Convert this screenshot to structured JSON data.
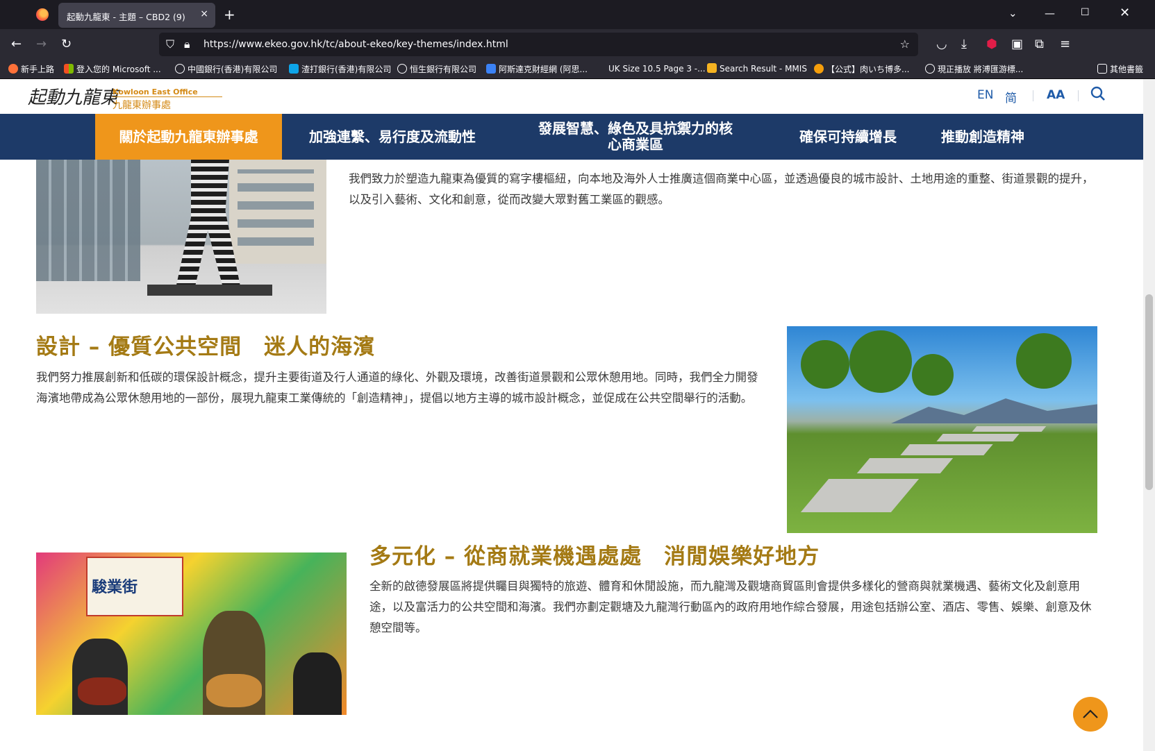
{
  "browser": {
    "tab_title": "起動九龍東 - 主題 – CBD2 (9)",
    "tab_close": "×",
    "new_tab": "+",
    "url": "https://www.ekeo.gov.hk/tc/about-ekeo/key-themes/index.html",
    "bookmarks": [
      {
        "label": "新手上路",
        "color": "#ff7139"
      },
      {
        "label": "登入您的 Microsoft ...",
        "color": "#f25022"
      },
      {
        "label": "中國銀行(香港)有限公司",
        "color": "#8f8f9d"
      },
      {
        "label": "渣打銀行(香港)有限公司",
        "color": "#0ea5e9"
      },
      {
        "label": "恒生銀行有限公司",
        "color": "#8f8f9d"
      },
      {
        "label": "阿斯達克財經網 (阿思...",
        "color": "#3b82f6"
      },
      {
        "label": "UK Size 10.5 Page 3 -...",
        "color": "#2b2a33"
      },
      {
        "label": "Search Result - MMIS",
        "color": "#f5b321"
      },
      {
        "label": "【公式】肉いち博多...",
        "color": "#f59e0b"
      },
      {
        "label": "現正播放 將溥匯游標...",
        "color": "#8f8f9d"
      }
    ],
    "other_bookmarks": "其他書籤"
  },
  "site": {
    "logo_script": "起動九龍東",
    "logo_en": "Kowloon East Office",
    "logo_zh": "九龍東辦事處",
    "lang_en": "EN",
    "lang_sc": "简",
    "font_size": "AA"
  },
  "nav": {
    "items": [
      {
        "label": "關於起動九龍東辦事處"
      },
      {
        "label": "加強連繫、易行度及流動性"
      },
      {
        "label": "發展智慧、綠色及具抗禦力的核心商業區"
      },
      {
        "label": "確保可持續增長"
      },
      {
        "label": "推動創造精神"
      }
    ]
  },
  "sections": {
    "s1": {
      "text": "我們致力於塑造九龍東為優質的寫字樓樞紐，向本地及海外人士推廣這個商業中心區，並透過優良的城市設計、土地用途的重整、街道景觀的提升，以及引入藝術、文化和創意，從而改變大眾對舊工業區的觀感。"
    },
    "s2": {
      "title": "設計 – 優質公共空間　迷人的海濱",
      "text": "我們努力推展創新和低碳的環保設計概念，提升主要街道及行人通道的綠化、外觀及環境，改善街道景觀和公眾休憩用地。同時，我們全力開發海濱地帶成為公眾休憩用地的一部份，展現九龍東工業傳統的「創造精神」，提倡以地方主導的城市設計概念，並促成在公共空間舉行的活動。"
    },
    "s3": {
      "title": "多元化 – 從商就業機遇處處　消閒娛樂好地方",
      "text": "全新的啟德發展區將提供矚目與獨特的旅遊、體育和休閒設施，而九龍灣及觀塘商貿區則會提供多樣化的營商與就業機遇、藝術文化及創意用途，以及富活力的公共空間和海濱。我們亦劃定觀塘及九龍灣行動區內的政府用地作綜合發展，用途包括辦公室、酒店、零售、娛樂、創意及休憩空間等。",
      "photo_sign": "駿業街"
    }
  },
  "colors": {
    "nav_bg": "#1d3a68",
    "accent": "#ef961b",
    "title": "#a47a14"
  }
}
